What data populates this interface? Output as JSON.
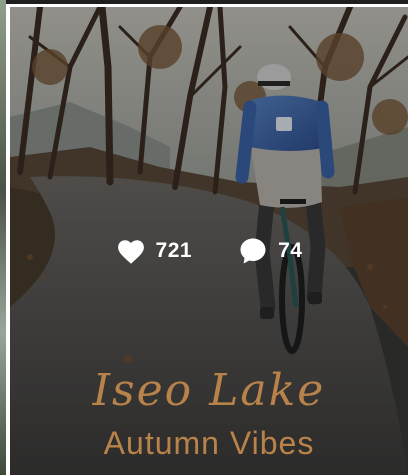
{
  "post": {
    "likes": "721",
    "comments": "74",
    "caption_title": "Iseo Lake",
    "caption_subtitle": "Autumn Vibes"
  },
  "icons": {
    "likes": "heart-icon",
    "comments": "speech-bubble-icon"
  },
  "colors": {
    "caption": "#b8834a",
    "stat_text": "#ffffff"
  }
}
